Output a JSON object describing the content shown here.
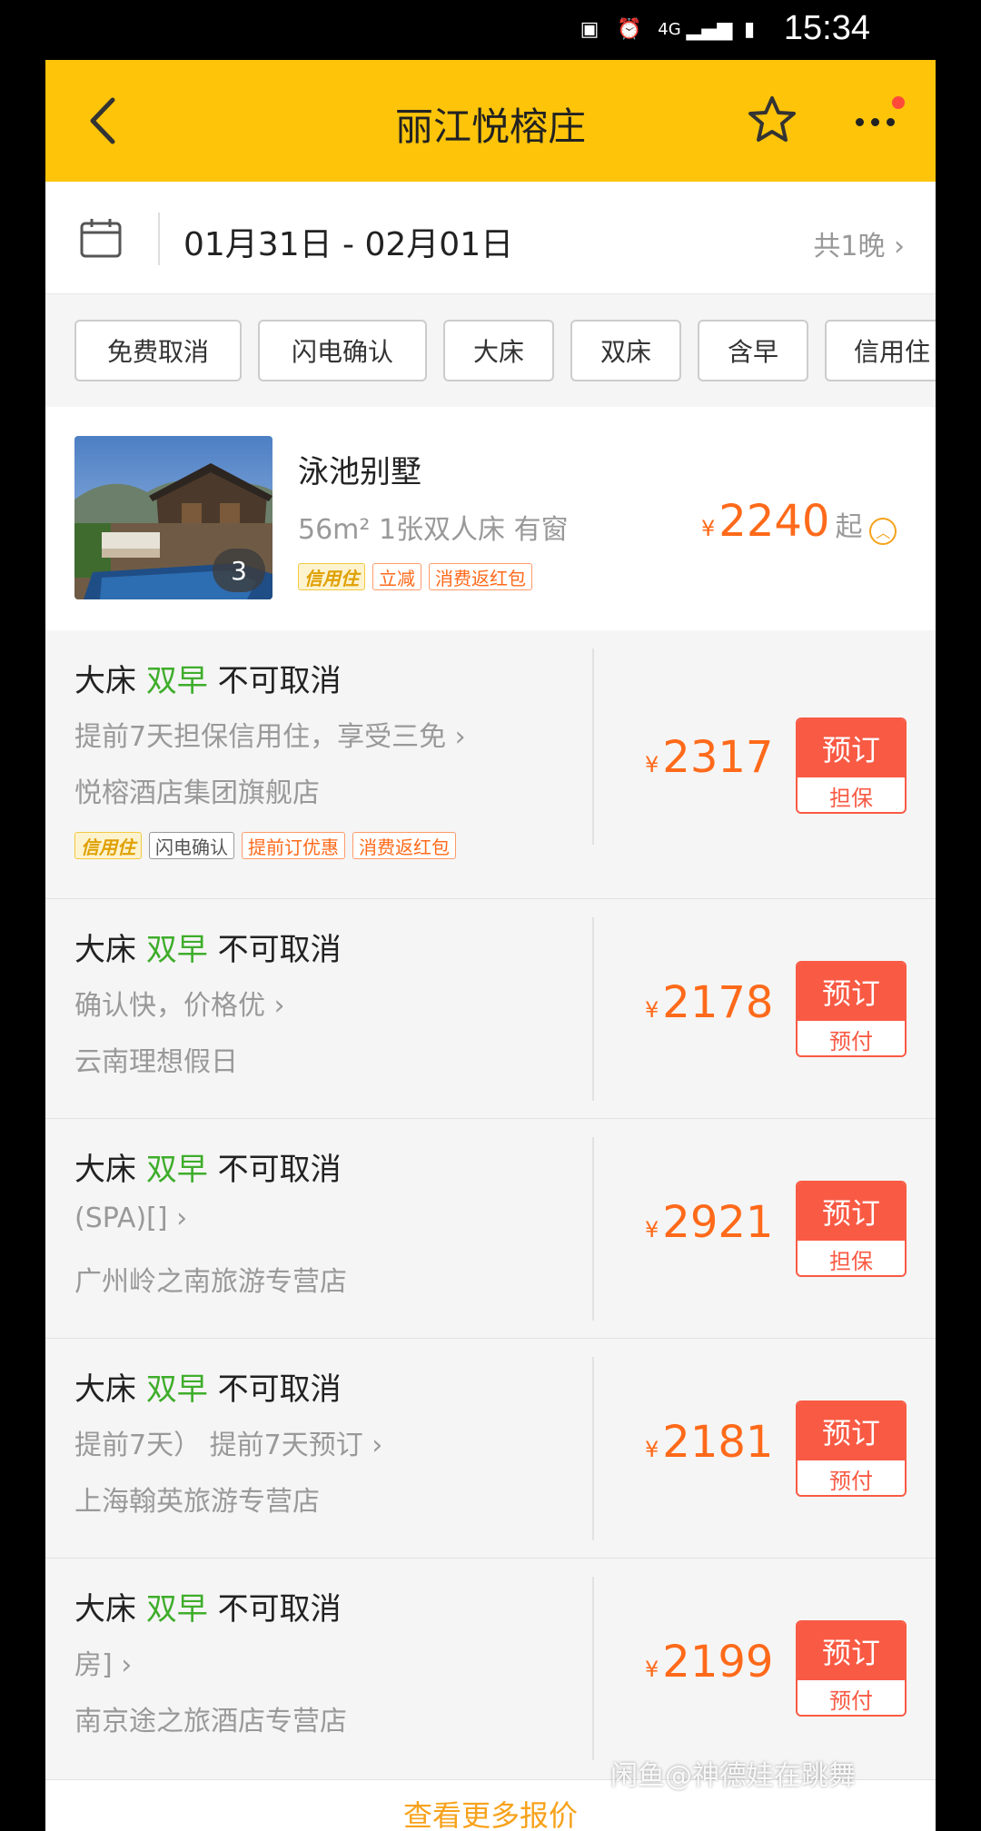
{
  "status_bar": {
    "time": "15:34",
    "network": "4G"
  },
  "header": {
    "title": "丽江悦榕庄"
  },
  "datebar": {
    "dates": "01月31日 - 02月01日",
    "nights": "共1晚 ›"
  },
  "filters": [
    "免费取消",
    "闪电确认",
    "大床",
    "双床",
    "含早",
    "信用住"
  ],
  "room": {
    "name": "泳池别墅",
    "spec": "56m² 1张双人床 有窗",
    "image_count": "3",
    "currency": "¥",
    "price": "2240",
    "price_suffix": "起",
    "tags": [
      "信用住",
      "立减",
      "消费返红包"
    ]
  },
  "offers": [
    {
      "bed": "大床",
      "breakfast": "双早",
      "cancel": "不可取消",
      "desc": "提前7天担保信用住，享受三免 ›",
      "shop": "悦榕酒店集团旗舰店",
      "tags": [
        "信用住",
        "闪电确认",
        "提前订优惠",
        "消费返红包"
      ],
      "currency": "¥",
      "price": "2317",
      "book_label": "预订",
      "pay_type": "担保"
    },
    {
      "bed": "大床",
      "breakfast": "双早",
      "cancel": "不可取消",
      "desc": "确认快，价格优 ›",
      "shop": "云南理想假日",
      "currency": "¥",
      "price": "2178",
      "book_label": "预订",
      "pay_type": "预付"
    },
    {
      "bed": "大床",
      "breakfast": "双早",
      "cancel": "不可取消",
      "desc": "(SPA)[] ›",
      "shop": "广州岭之南旅游专营店",
      "currency": "¥",
      "price": "2921",
      "book_label": "预订",
      "pay_type": "担保"
    },
    {
      "bed": "大床",
      "breakfast": "双早",
      "cancel": "不可取消",
      "desc": "提前7天） 提前7天预订 ›",
      "shop": "上海翰英旅游专营店",
      "currency": "¥",
      "price": "2181",
      "book_label": "预订",
      "pay_type": "预付"
    },
    {
      "bed": "大床",
      "breakfast": "双早",
      "cancel": "不可取消",
      "desc": "房] ›",
      "shop": "南京途之旅酒店专营店",
      "currency": "¥",
      "price": "2199",
      "book_label": "预订",
      "pay_type": "预付"
    }
  ],
  "more_prices": "查看更多报价",
  "watermark": "闲鱼@神德娃在跳舞",
  "colors": {
    "header": "#fdc40a",
    "price": "#ff6a1a",
    "book": "#f95a44",
    "green": "#3fad2b"
  },
  "icons": [
    "back-arrow-icon",
    "star-icon",
    "more-icon",
    "calendar-icon",
    "chevron-up-circle-icon"
  ]
}
